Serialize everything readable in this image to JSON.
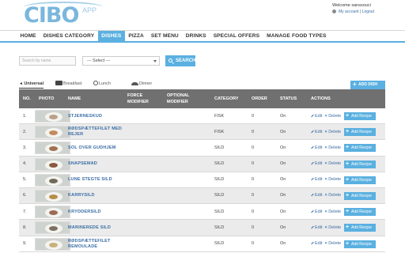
{
  "header": {
    "logo": "CIBO",
    "logo_suffix": "APP",
    "welcome": "Welcome sanssouci",
    "my_account": "My account",
    "separator": "|",
    "logout": "Logout"
  },
  "nav": {
    "items": [
      {
        "label": "HOME",
        "active": false
      },
      {
        "label": "DISHES CATEGORY",
        "active": false
      },
      {
        "label": "DISHES",
        "active": true
      },
      {
        "label": "PIZZA",
        "active": false
      },
      {
        "label": "SET MENU",
        "active": false
      },
      {
        "label": "DRINKS",
        "active": false
      },
      {
        "label": "SPECIAL OFFERS",
        "active": false
      },
      {
        "label": "MANAGE FOOD TYPES",
        "active": false
      }
    ]
  },
  "filters": {
    "search_placeholder": "Search by name",
    "select_value": "--- Select ---",
    "search_button": "SEARCH"
  },
  "tabs": [
    {
      "label": "Universal",
      "icon": "tab-arrow-icon",
      "active": true
    },
    {
      "label": "Breakfast",
      "icon": "breakfast-icon",
      "active": false
    },
    {
      "label": "Lunch",
      "icon": "lunch-icon",
      "active": false
    },
    {
      "label": "Dinner",
      "icon": "dinner-icon",
      "active": false
    }
  ],
  "add_dish_button": "ADD DISH",
  "table": {
    "headers": {
      "no": "NO.",
      "photo": "PHOTO",
      "name": "NAME",
      "force_modifier": "FORCE MODIFIER",
      "optional_modifier": "OPTIONAL MODIFIER",
      "category": "CATEGORY",
      "order": "ORDER",
      "status": "STATUS",
      "actions": "ACTIONS"
    },
    "edit_label": "Edit",
    "delete_label": "Delete",
    "add_recipe_label": "Add Recipe",
    "rows": [
      {
        "no": "1.",
        "name": "STJERNESKUD",
        "category": "FISK",
        "order": "0",
        "status": "On",
        "food_color": "#b9a08a"
      },
      {
        "no": "2.",
        "name": "RØDSPÆTTEFILET MED REJER",
        "category": "FISK",
        "order": "0",
        "status": "On",
        "food_color": "#c58a5e"
      },
      {
        "no": "3.",
        "name": "SOL OVER GUDHJEM",
        "category": "SILD",
        "order": "0",
        "status": "On",
        "food_color": "#a07050"
      },
      {
        "no": "4.",
        "name": "SNAPSEMAD",
        "category": "SILD",
        "order": "0",
        "status": "On",
        "food_color": "#8a5a3c"
      },
      {
        "no": "5.",
        "name": "LUNE STEGTE SILD",
        "category": "SILD",
        "order": "0",
        "status": "On",
        "food_color": "#6f6a5a"
      },
      {
        "no": "6.",
        "name": "KARRYSILD",
        "category": "SILD",
        "order": "0",
        "status": "On",
        "food_color": "#b58f4a"
      },
      {
        "no": "7.",
        "name": "KRYDDERSILD",
        "category": "SILD",
        "order": "0",
        "status": "On",
        "food_color": "#9c6a56"
      },
      {
        "no": "8.",
        "name": "MARINEREDE SILD",
        "category": "SILD",
        "order": "0",
        "status": "On",
        "food_color": "#7d7060"
      },
      {
        "no": "9.",
        "name": "RØDSPÆTTEFILET REMOULADE",
        "category": "SILD",
        "order": "0",
        "status": "On",
        "food_color": "#c9b07a"
      }
    ]
  },
  "colors": {
    "accent": "#5ab0e0",
    "table_header": "#707070",
    "link": "#3a6ea5"
  }
}
